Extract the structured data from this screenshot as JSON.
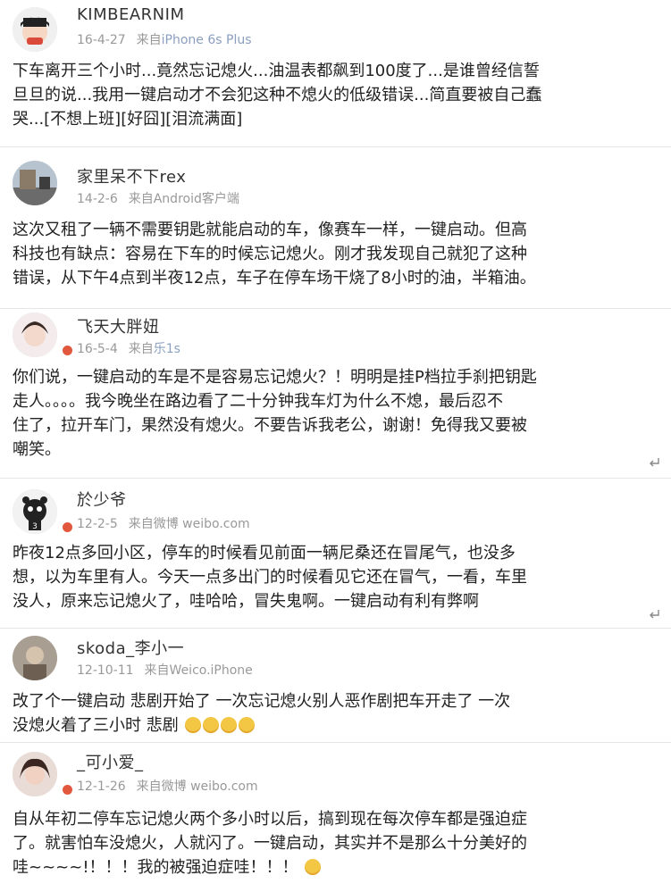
{
  "posts": [
    {
      "username": "KIMBEARNIM",
      "date": "16-4-27",
      "source_prefix": "来自",
      "source": "iPhone 6s Plus",
      "lines": [
        "下车离开三个小时...竟然忘记熄火...油温表都飙到100度了...是谁曾经信誓",
        "旦旦的说...我用一键启动才不会犯这种不熄火的低级错误...简直要被自己蠢",
        "哭...[不想上班][好囧][泪流满面]"
      ]
    },
    {
      "username": "家里呆不下rex",
      "date": "14-2-6",
      "source_prefix": "来自",
      "source": "Android客户端",
      "lines": [
        "这次又租了一辆不需要钥匙就能启动的车，像赛车一样，一键启动。但高",
        "科技也有缺点：容易在下车的时候忘记熄火。刚才我发现自己就犯了这种",
        "错误，从下午4点到半夜12点，车子在停车场干烧了8小时的油，半箱油。"
      ]
    },
    {
      "username": "飞天大胖妞",
      "date": "16-5-4",
      "source_prefix": "来自",
      "source": "乐1s",
      "lines": [
        "你们说，一键启动的车是不是容易忘记熄火？！明明是挂P档拉手刹把钥匙",
        "走人。。。。我今晚坐在路边看了二十分钟我车灯为什么不熄，最后忍不",
        "住了，拉开车门，果然没有熄火。不要告诉我老公，谢谢！免得我又要被",
        "嘲笑。"
      ]
    },
    {
      "username": "於少爷",
      "date": "12-2-5",
      "source_prefix": "来自",
      "source": "微博 weibo.com",
      "lines": [
        "昨夜12点多回小区，停车的时候看见前面一辆尼桑还在冒尾气，也没多",
        "想，以为车里有人。今天一点多出门的时候看见它还在冒气，一看，车里",
        "没人，原来忘记熄火了，哇哈哈，冒失鬼啊。一键启动有利有弊啊"
      ]
    },
    {
      "username": "skoda_李小一",
      "date": "12-10-11",
      "source_prefix": "来自",
      "source": "Weico.iPhone",
      "lines": [
        "改了个一键启动  悲剧开始了  一次忘记熄火别人恶作剧把车开走了  一次",
        "没熄火着了三小时  悲剧"
      ]
    },
    {
      "username": "_可小爱_",
      "date": "12-1-26",
      "source_prefix": "来自",
      "source": "微博 weibo.com",
      "lines": [
        "自从年初二停车忘记熄火两个多小时以后，搞到现在每次停车都是强迫症",
        "了。就害怕车没熄火，人就闪了。一键启动，其实并不是那么十分美好的",
        "哇~~~~!！！！我的被强迫症哇！！！"
      ]
    }
  ]
}
